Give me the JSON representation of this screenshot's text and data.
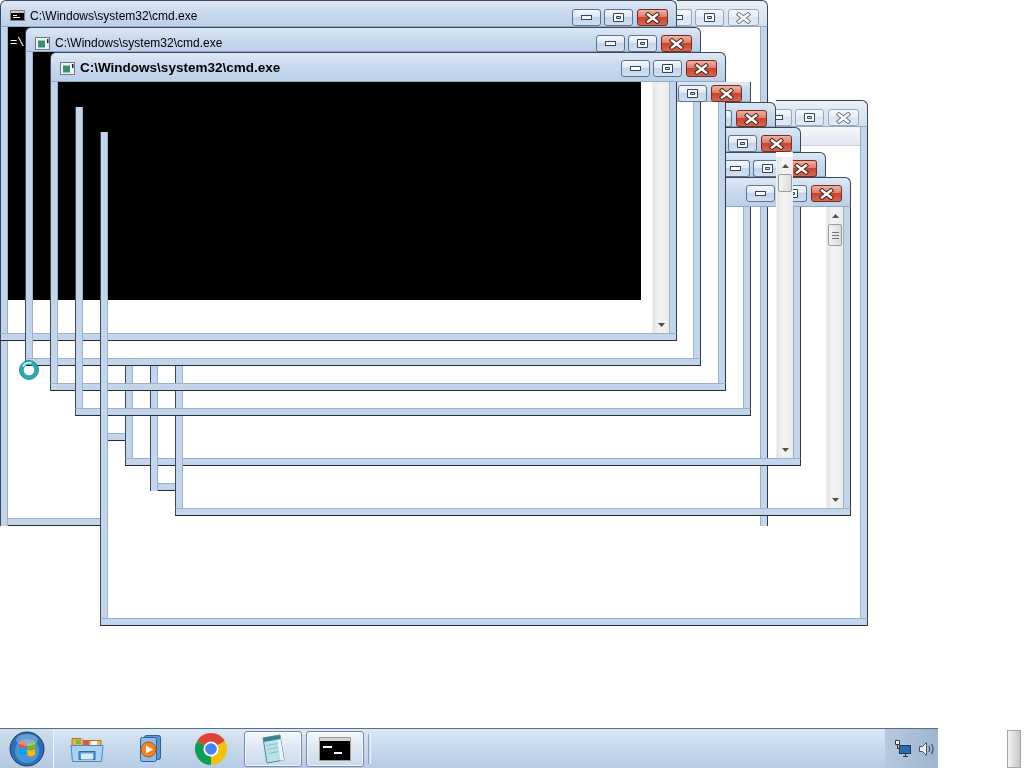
{
  "desktop": {
    "windows": [
      {
        "kind": "document",
        "active": false
      },
      {
        "kind": "console",
        "title": "C:\\Windows\\system32\\cmd.exe",
        "active": true,
        "focused": false,
        "console_text": "=\\"
      },
      {
        "kind": "window",
        "title": "C:\\Windows\\system32\\cmd.exe",
        "active": true,
        "focused": false
      },
      {
        "kind": "window",
        "title": "C:\\Windows\\system32\\cmd.exe",
        "active": true,
        "focused": true
      },
      {
        "kind": "window",
        "active": true
      },
      {
        "kind": "window",
        "active": true
      },
      {
        "kind": "window",
        "active": true
      },
      {
        "kind": "window",
        "active": true
      },
      {
        "kind": "window",
        "active": true
      },
      {
        "kind": "document",
        "active": false
      }
    ]
  },
  "taskbar": {
    "items": [
      {
        "kind": "folder",
        "running": false
      },
      {
        "kind": "media",
        "running": false
      },
      {
        "kind": "browser",
        "running": false
      },
      {
        "kind": "notepad",
        "running": true
      },
      {
        "kind": "terminal",
        "running": true
      }
    ]
  }
}
